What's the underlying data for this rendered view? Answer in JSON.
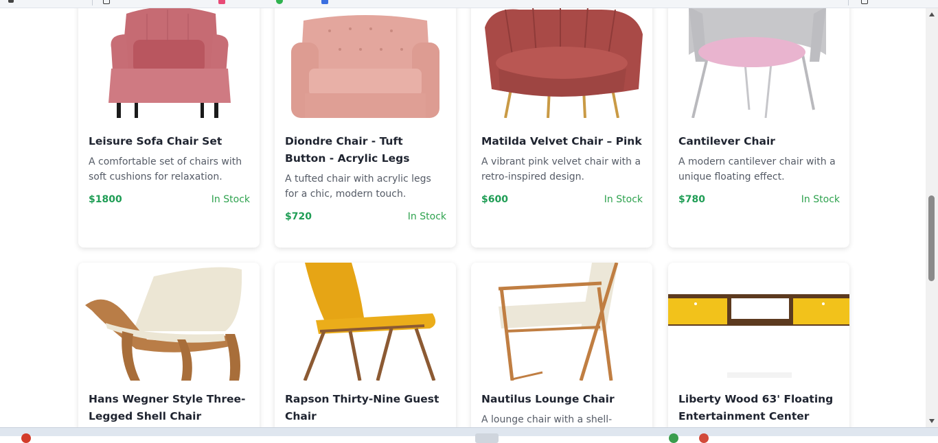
{
  "products": [
    {
      "title": "Leisure Sofa Chair Set",
      "desc": "A comfortable set of chairs with soft cushions for relaxation.",
      "price": "$1800",
      "stock": "In Stock",
      "image": "pink-wingback-chair"
    },
    {
      "title": "Diondre Chair - Tuft Button - Acrylic Legs",
      "desc": "A tufted chair with acrylic legs for a chic, modern touch.",
      "price": "$720",
      "stock": "In Stock",
      "image": "pink-tufted-armchair"
    },
    {
      "title": "Matilda Velvet Chair – Pink",
      "desc": "A vibrant pink velvet chair with a retro-inspired design.",
      "price": "$600",
      "stock": "In Stock",
      "image": "pink-velvet-shell-chair"
    },
    {
      "title": "Cantilever Chair",
      "desc": "A modern cantilever chair with a unique floating effect.",
      "price": "$780",
      "stock": "In Stock",
      "image": "grey-cantilever-chair"
    },
    {
      "title": "Hans Wegner Style Three-Legged Shell Chair",
      "image": "wooden-shell-chair"
    },
    {
      "title": "Rapson Thirty-Nine Guest Chair",
      "image": "yellow-guest-chair"
    },
    {
      "title": "Nautilus Lounge Chair",
      "desc": "A lounge chair with a shell-",
      "image": "wooden-lounge-chair"
    },
    {
      "title": "Liberty Wood 63' Floating Entertainment Center",
      "image": "floating-entertainment-center"
    }
  ],
  "colors": {
    "price": "#1f9d55",
    "stock": "#2ea24e",
    "title": "#1f2430",
    "desc": "#555b66"
  }
}
